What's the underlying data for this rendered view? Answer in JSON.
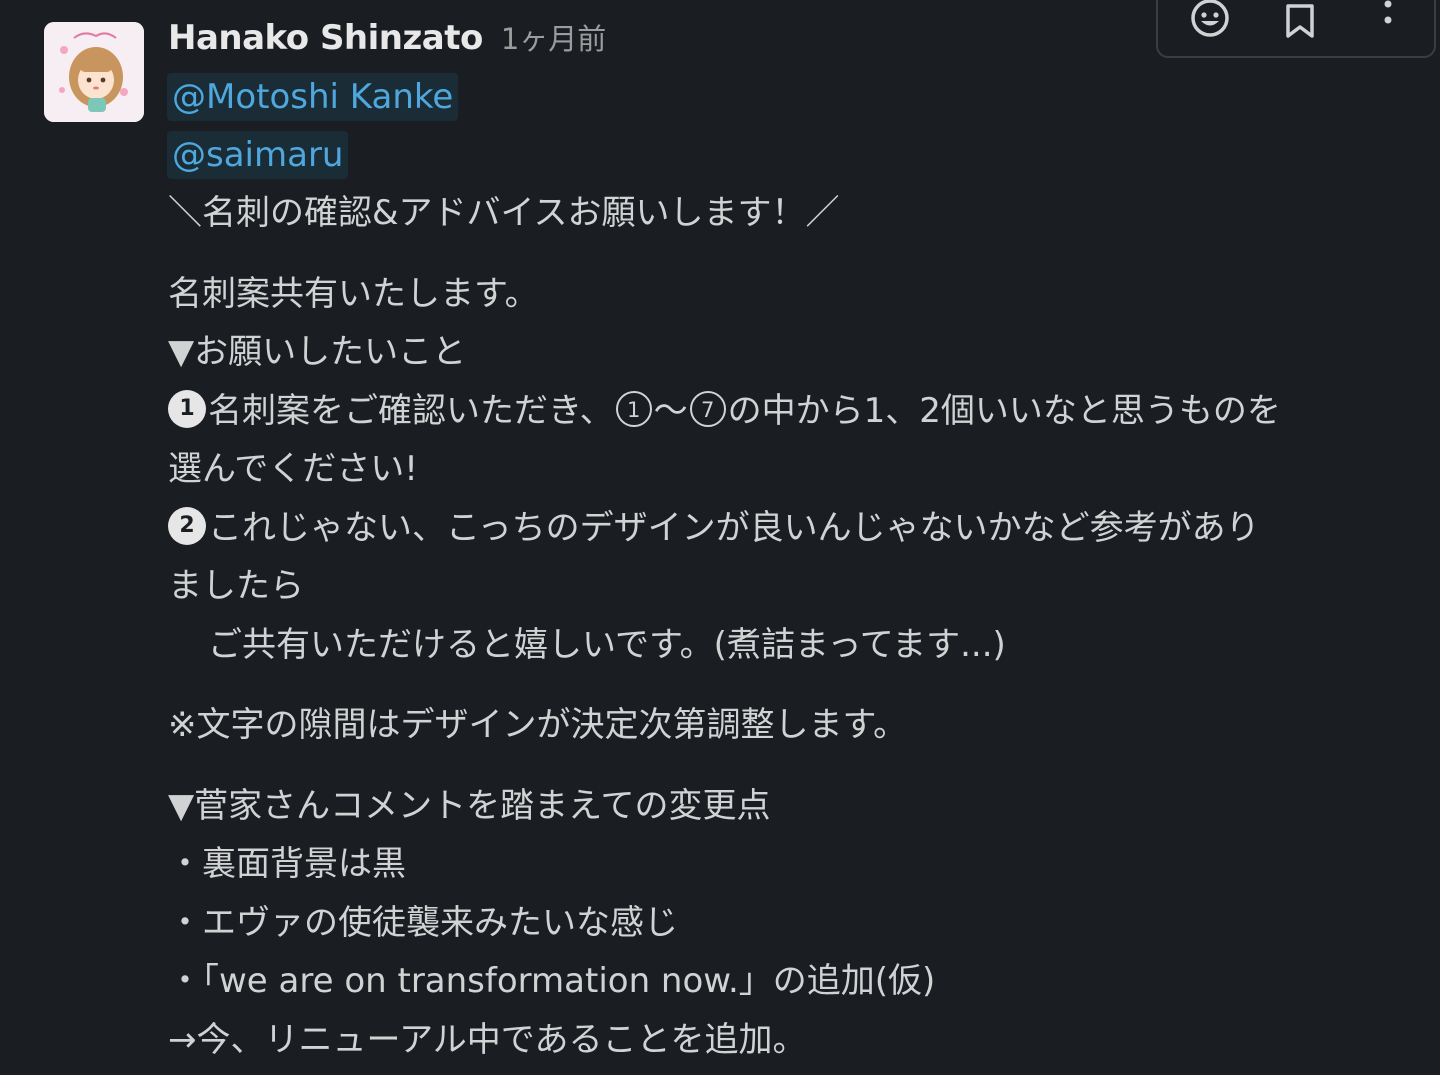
{
  "message": {
    "author": "Hanako Shinzato",
    "timestamp": "1ヶ月前",
    "mentions": [
      "@Motoshi Kanke",
      "@saimaru"
    ],
    "lines": {
      "headline": "＼名刺の確認&アドバイスお願いします！／",
      "intro": "名刺案共有いたします。",
      "request_title": "▼お願いしたいこと",
      "item1_badge": "1",
      "item1_a": "名刺案をご確認いただき、",
      "item1_c1": "1",
      "item1_tilde": "〜",
      "item1_c7": "7",
      "item1_b": "の中から1、2個いいなと思うものを",
      "item1_cont": "選んでください!",
      "item2_badge": "2",
      "item2_a": "これじゃない、こっちのデザインが良いんじゃないかなど参考があり",
      "item2_cont": "ましたら",
      "item2_cont2": "ご共有いただけると嬉しいです。(煮詰まってます...)",
      "note": "※文字の隙間はデザインが決定次第調整します。",
      "changes_title": "▼菅家さんコメントを踏まえての変更点",
      "change1": "・裏面背景は黒",
      "change2": "・エヴァの使徒襲来みたいな感じ",
      "change3": "・「we are on transformation now.」の追加(仮)",
      "change4": "→今、リニューアル中であることを追加。"
    }
  },
  "toolbar": {
    "icons": [
      "emoji-reaction-icon",
      "bookmark-icon",
      "more-actions-icon"
    ]
  },
  "colors": {
    "background": "#1a1d21",
    "text": "#d1d2d3",
    "mention": "#4fa7dd",
    "timestamp": "#9b9c9e"
  }
}
